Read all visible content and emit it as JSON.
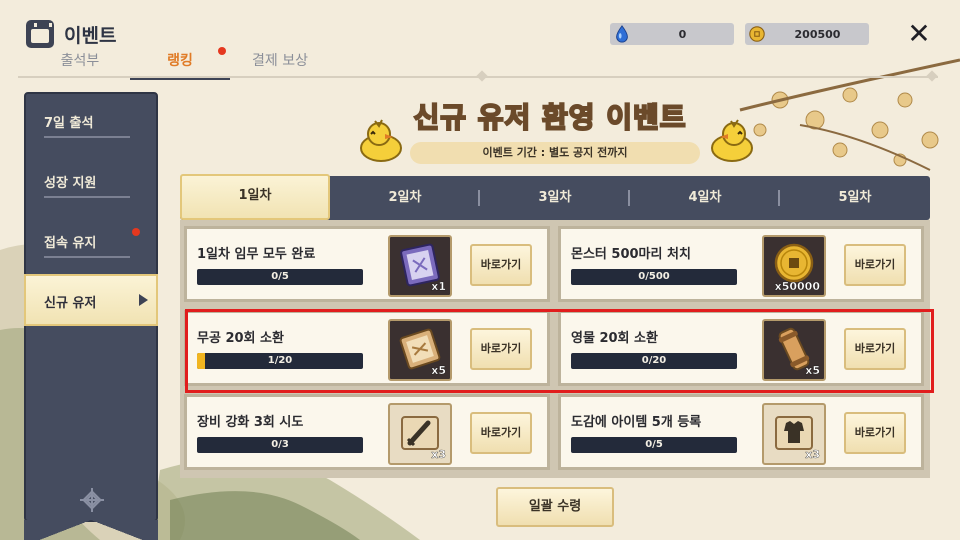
{
  "header": {
    "title": "이벤트",
    "tabs": [
      {
        "label": "출석부",
        "active": false,
        "has_dot": false
      },
      {
        "label": "랭킹",
        "active": true,
        "has_dot": true
      },
      {
        "label": "결제 보상",
        "active": false,
        "has_dot": false
      }
    ],
    "currencies": [
      {
        "icon": "water-drop-icon",
        "value": "0"
      },
      {
        "icon": "gold-coin-icon",
        "value": "200500"
      }
    ]
  },
  "sidebar": {
    "items": [
      {
        "label": "7일 출석",
        "active": false,
        "has_dot": false
      },
      {
        "label": "성장 지원",
        "active": false,
        "has_dot": false
      },
      {
        "label": "접속 유지",
        "active": false,
        "has_dot": true
      },
      {
        "label": "신규 유저",
        "active": true,
        "has_dot": false
      }
    ]
  },
  "banner": {
    "title": "신규 유저 환영 이벤트",
    "period": "이벤트 기간 : 별도 공지 전까지"
  },
  "day_tabs": [
    {
      "label": "1일차",
      "active": true
    },
    {
      "label": "2일차",
      "active": false
    },
    {
      "label": "3일차",
      "active": false
    },
    {
      "label": "4일차",
      "active": false
    },
    {
      "label": "5일차",
      "active": false
    }
  ],
  "missions": [
    {
      "title": "1일차 임무 모두 완료",
      "progress_text": "0/5",
      "progress": 0.0,
      "reward_icon": "purple-scroll-icon",
      "reward_qty": "x1",
      "button": "바로가기"
    },
    {
      "title": "몬스터 500마리 처치",
      "progress_text": "0/500",
      "progress": 0.0,
      "reward_icon": "gold-coin-icon",
      "reward_qty": "x50000",
      "button": "바로가기"
    },
    {
      "title": "무공 20회 소환",
      "progress_text": "1/20",
      "progress": 0.05,
      "reward_icon": "martial-scroll-icon",
      "reward_qty": "x5",
      "button": "바로가기"
    },
    {
      "title": "영물 20회 소환",
      "progress_text": "0/20",
      "progress": 0.0,
      "reward_icon": "rolled-scroll-icon",
      "reward_qty": "x5",
      "button": "바로가기"
    },
    {
      "title": "장비 강화 3회 시도",
      "progress_text": "0/3",
      "progress": 0.0,
      "reward_icon": "weapon-scroll-icon",
      "reward_qty": "x3",
      "button": "바로가기"
    },
    {
      "title": "도감에 아이템 5개 등록",
      "progress_text": "0/5",
      "progress": 0.0,
      "reward_icon": "armor-scroll-icon",
      "reward_qty": "x3",
      "button": "바로가기"
    }
  ],
  "claim_all": "일괄 수령",
  "colors": {
    "navy": "#454c5f",
    "accent_orange": "#e07b26",
    "progress_fill": "#f1b520",
    "highlight_red": "#e11d1d"
  }
}
